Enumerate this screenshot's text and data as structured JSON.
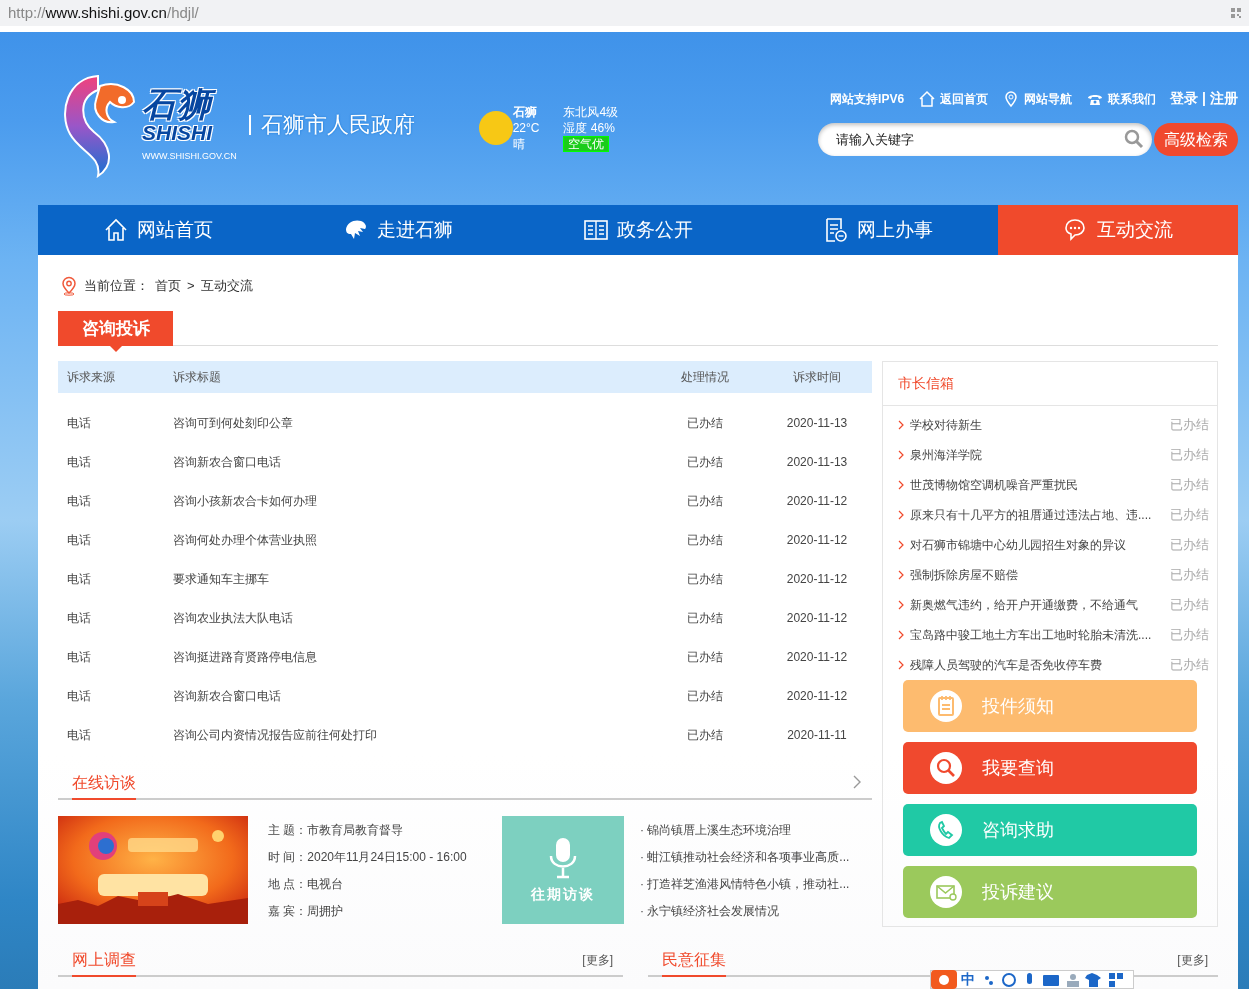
{
  "address_bar": {
    "scheme": "http://",
    "host": "www.shishi.gov.cn",
    "path": "/hdjl/"
  },
  "logo": {
    "name_cn": "石狮",
    "name_en": "SHISHI",
    "domain": "WWW.SHISHI.GOV.CN",
    "title": "石狮市人民政府"
  },
  "weather": {
    "city": "石狮",
    "temperature": "22°C",
    "condition": "晴",
    "wind": "东北风4级",
    "humidity": "湿度 46%",
    "air_quality": "空气优"
  },
  "top_links": [
    {
      "label": "网站支持IPV6",
      "kind": "plain"
    },
    {
      "label": "返回首页",
      "kind": "home"
    },
    {
      "label": "网站导航",
      "kind": "pin"
    },
    {
      "label": "联系我们",
      "kind": "phone"
    }
  ],
  "auth_links": {
    "login": "登录",
    "separator": "|",
    "register": "注册"
  },
  "search": {
    "placeholder": "请输入关键字",
    "advanced_button": "高级检索"
  },
  "nav": [
    {
      "label": "网站首页",
      "kind": "home",
      "selected": false
    },
    {
      "label": "走进石狮",
      "kind": "lion",
      "selected": false
    },
    {
      "label": "政务公开",
      "kind": "book",
      "selected": false
    },
    {
      "label": "网上办事",
      "kind": "document",
      "selected": false
    },
    {
      "label": "互动交流",
      "kind": "chat",
      "selected": true
    }
  ],
  "breadcrumb": {
    "label": "当前位置：",
    "items": [
      "首页",
      "互动交流"
    ],
    "separator": ">"
  },
  "section_title": "咨询投诉",
  "table": {
    "columns": [
      "诉求来源",
      "诉求标题",
      "处理情况",
      "诉求时间"
    ],
    "rows": [
      [
        "电话",
        "咨询可到何处刻印公章",
        "已办结",
        "2020-11-13"
      ],
      [
        "电话",
        "咨询新农合窗口电话",
        "已办结",
        "2020-11-13"
      ],
      [
        "电话",
        "咨询小孩新农合卡如何办理",
        "已办结",
        "2020-11-12"
      ],
      [
        "电话",
        "咨询何处办理个体营业执照",
        "已办结",
        "2020-11-12"
      ],
      [
        "电话",
        "要求通知车主挪车",
        "已办结",
        "2020-11-12"
      ],
      [
        "电话",
        "咨询农业执法大队电话",
        "已办结",
        "2020-11-12"
      ],
      [
        "电话",
        "咨询挺进路育贤路停电信息",
        "已办结",
        "2020-11-12"
      ],
      [
        "电话",
        "咨询新农合窗口电话",
        "已办结",
        "2020-11-12"
      ],
      [
        "电话",
        "咨询公司内资情况报告应前往何处打印",
        "已办结",
        "2020-11-11"
      ]
    ]
  },
  "mailbox": {
    "title": "市长信箱",
    "items": [
      {
        "title": "学校对待新生",
        "status": "已办结"
      },
      {
        "title": "泉州海洋学院",
        "status": "已办结"
      },
      {
        "title": "世茂博物馆空调机噪音严重扰民",
        "status": "已办结"
      },
      {
        "title": "原来只有十几平方的祖厝通过违法占地、违....",
        "status": "已办结"
      },
      {
        "title": "对石狮市锦塘中心幼儿园招生对象的异议",
        "status": "已办结"
      },
      {
        "title": "强制拆除房屋不赔偿",
        "status": "已办结"
      },
      {
        "title": "新奥燃气违约，给开户开通缴费，不给通气",
        "status": "已办结"
      },
      {
        "title": "宝岛路中骏工地土方车出工地时轮胎未清洗....",
        "status": "已办结"
      },
      {
        "title": "残障人员驾驶的汽车是否免收停车费",
        "status": "已办结"
      }
    ]
  },
  "action_buttons": [
    {
      "label": "投件须知",
      "kind": "notepad",
      "color": "#fdbb6f"
    },
    {
      "label": "我要查询",
      "kind": "search",
      "color": "#f0492e"
    },
    {
      "label": "咨询求助",
      "kind": "phone",
      "color": "#20c9a5"
    },
    {
      "label": "投诉建议",
      "kind": "mail",
      "color": "#9bc95c"
    }
  ],
  "interview": {
    "title": "在线访谈",
    "image": {
      "kind": "picture"
    },
    "details": [
      "主 题：市教育局教育督导",
      "时 间：2020年11月24日15:00 - 16:00",
      "地 点：电视台",
      "嘉 宾：周拥护"
    ],
    "past_button": "往期访谈",
    "links": [
      "· 锦尚镇厝上溪生态环境治理",
      "· 蚶江镇推动社会经济和各项事业高质...",
      "· 打造祥芝渔港风情特色小镇，推动社...",
      "· 永宁镇经济社会发展情况"
    ]
  },
  "bottom_sections": [
    {
      "title": "网上调查",
      "more": "[更多]"
    },
    {
      "title": "民意征集",
      "more": "[更多]"
    }
  ],
  "ime_toolbar": {
    "mode": "中"
  }
}
